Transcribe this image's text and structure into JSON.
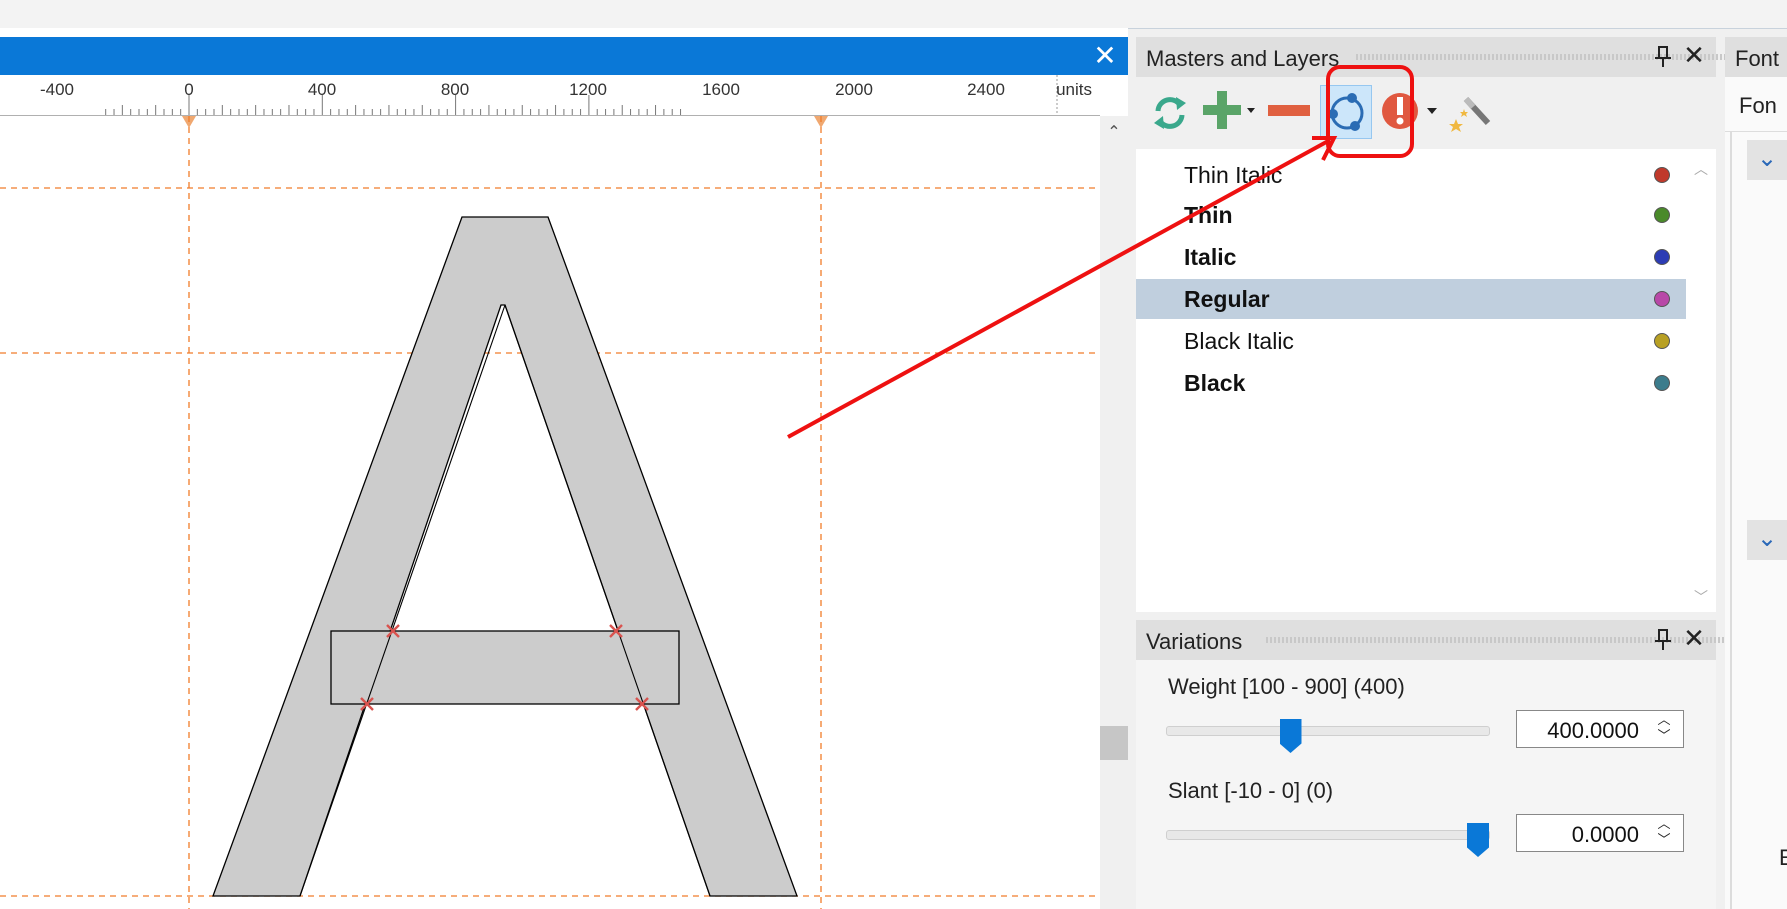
{
  "editor": {
    "close_icon": "close-icon",
    "ruler": {
      "labels": [
        "-400",
        "0",
        "400",
        "800",
        "1200",
        "1600",
        "2000",
        "2400"
      ],
      "units": "units"
    },
    "glyph": "A",
    "colors": {
      "glyph_fill": "#cccccc",
      "guide": "#f07c2a",
      "node": "#d9534f"
    }
  },
  "masters_panel": {
    "title": "Masters and Layers",
    "pin_icon": "pin-icon",
    "close_icon": "close-icon",
    "toolbar": [
      {
        "icon": "refresh-icon"
      },
      {
        "icon": "add-icon"
      },
      {
        "icon": "remove-icon"
      },
      {
        "icon": "interpolate-icon",
        "active": true
      },
      {
        "icon": "warning-icon"
      },
      {
        "icon": "magic-wand-icon"
      }
    ],
    "masters": [
      {
        "name": "Thin Italic",
        "bold": false,
        "color": "#c0392b"
      },
      {
        "name": "Thin",
        "bold": true,
        "color": "#4a8a2a"
      },
      {
        "name": "Italic",
        "bold": true,
        "color": "#2c3cb4"
      },
      {
        "name": "Regular",
        "bold": true,
        "color": "#b848a8",
        "selected": true
      },
      {
        "name": "Black Italic",
        "bold": false,
        "color": "#b8a024"
      },
      {
        "name": "Black",
        "bold": true,
        "color": "#3c7c8c"
      }
    ]
  },
  "variations_panel": {
    "title": "Variations",
    "axes": [
      {
        "label": "Weight [100 - 900] (400)",
        "value": "400.0000",
        "min": 100,
        "max": 900,
        "current": 400
      },
      {
        "label": "Slant [-10 - 0] (0)",
        "value": "0.0000",
        "min": -10,
        "max": 0,
        "current": 0
      }
    ]
  },
  "font_panel": {
    "title": "Font",
    "subtab": "Fon",
    "edge_char": "E"
  },
  "annotation": {
    "color": "#ee1111"
  }
}
